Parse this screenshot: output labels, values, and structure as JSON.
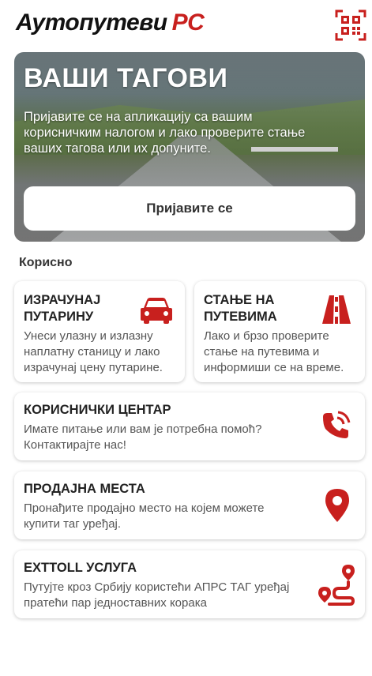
{
  "header": {
    "logo_text": "Аутопутеви",
    "logo_accent": "РС",
    "qr_icon": "qr-code-icon"
  },
  "hero": {
    "title": "ВАШИ ТАГОВИ",
    "text": "Пријавите се на апликацију са вашим корисничким налогом и лако проверите стање ваших тагова или их допуните.",
    "login_label": "Пријавите се"
  },
  "section": {
    "title": "Корисно"
  },
  "cards": {
    "toll": {
      "title": "ИЗРАЧУНАЈ ПУТАРИНУ",
      "desc": "Унеси улазну и излазну наплатну станицу и лако израчунај цену путарине.",
      "icon": "car-icon"
    },
    "roads": {
      "title": "СТАЊЕ НА ПУТЕВИМА",
      "desc": "Лако и брзо проверите стање на путевима и информиши се на време.",
      "icon": "road-icon"
    },
    "support": {
      "title": "КОРИСНИЧКИ ЦЕНТАР",
      "desc": "Имате питање или вам је потребна помоћ? Контактирајте нас!",
      "icon": "phone-call-icon"
    },
    "sales": {
      "title": "ПРОДАЈНА МЕСТА",
      "desc": "Пронађите продајно место на којем можете купити таг уређај.",
      "icon": "map-pin-icon"
    },
    "exttoll": {
      "title": "EXTTOLL УСЛУГА",
      "desc": "Путујте кроз Србију користећи АПРС ТАГ уређај пратећи пар једноставних корака",
      "icon": "route-icon"
    }
  },
  "colors": {
    "accent": "#c8201e",
    "text": "#222222",
    "muted": "#555555"
  }
}
